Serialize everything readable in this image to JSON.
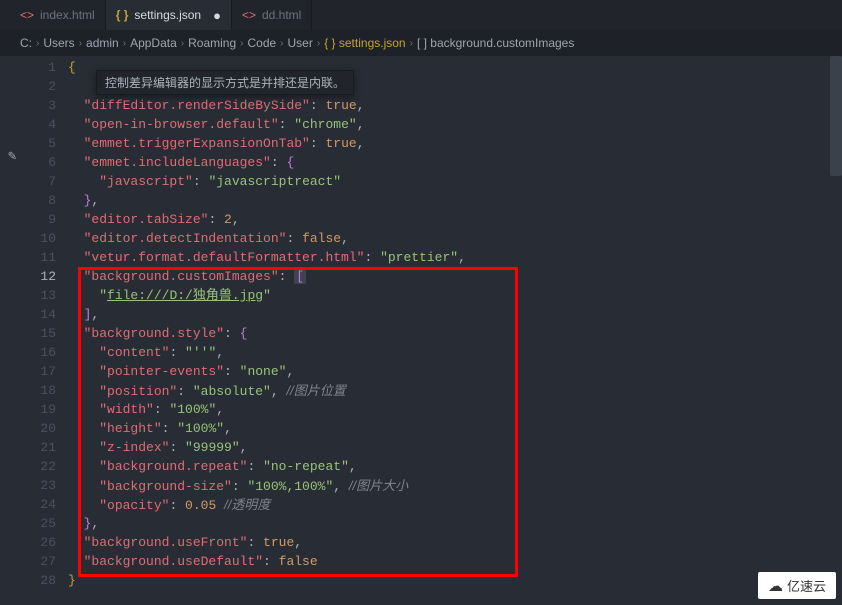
{
  "tabs": [
    {
      "icon_class": "file-icon-html",
      "icon": "<>",
      "label": "index.html",
      "active": false,
      "dirty": false
    },
    {
      "icon_class": "file-icon-json",
      "icon": "{ }",
      "label": "settings.json",
      "active": true,
      "dirty": true
    },
    {
      "icon_class": "file-icon-html",
      "icon": "<>",
      "label": "dd.html",
      "active": false,
      "dirty": false
    }
  ],
  "breadcrumb": [
    "C:",
    "Users",
    "admin",
    "AppData",
    "Roaming",
    "Code",
    "User",
    "{ } settings.json",
    "[ ] background.customImages"
  ],
  "tooltip": "控制差异编辑器的显示方式是并排还是内联。",
  "watermark": "亿速云",
  "code": {
    "l1_0": "{",
    "l3_k": "\"diffEditor.renderSideBySide\"",
    "l3_v": "true",
    "l4_k": "\"open-in-browser.default\"",
    "l4_v": "\"chrome\"",
    "l5_k": "\"emmet.triggerExpansionOnTab\"",
    "l5_v": "true",
    "l6_k": "\"emmet.includeLanguages\"",
    "l7_k": "\"javascript\"",
    "l7_v": "\"javascriptreact\"",
    "l9_k": "\"editor.tabSize\"",
    "l9_v": "2",
    "l10_k": "\"editor.detectIndentation\"",
    "l10_v": "false",
    "l11_k": "\"vetur.format.defaultFormatter.html\"",
    "l11_v": "\"prettier\"",
    "l12_k": "\"background.customImages\"",
    "l13_q1": "\"",
    "l13_link": "file:///D:/独角兽.jpg",
    "l13_q2": "\"",
    "l15_k": "\"background.style\"",
    "l16_k": "\"content\"",
    "l16_v": "\"''\"",
    "l17_k": "\"pointer-events\"",
    "l17_v": "\"none\"",
    "l18_k": "\"position\"",
    "l18_v": "\"absolute\"",
    "l18_c": "//图片位置",
    "l19_k": "\"width\"",
    "l19_v": "\"100%\"",
    "l20_k": "\"height\"",
    "l20_v": "\"100%\"",
    "l21_k": "\"z-index\"",
    "l21_v": "\"99999\"",
    "l22_k": "\"background.repeat\"",
    "l22_v": "\"no-repeat\"",
    "l23_k": "\"background-size\"",
    "l23_v": "\"100%,100%\"",
    "l23_c": "//图片大小",
    "l24_k": "\"opacity\"",
    "l24_v": "0.05",
    "l24_c": "//透明度",
    "l26_k": "\"background.useFront\"",
    "l26_v": "true",
    "l27_k": "\"background.useDefault\"",
    "l27_v": "false",
    "l28": "}"
  }
}
